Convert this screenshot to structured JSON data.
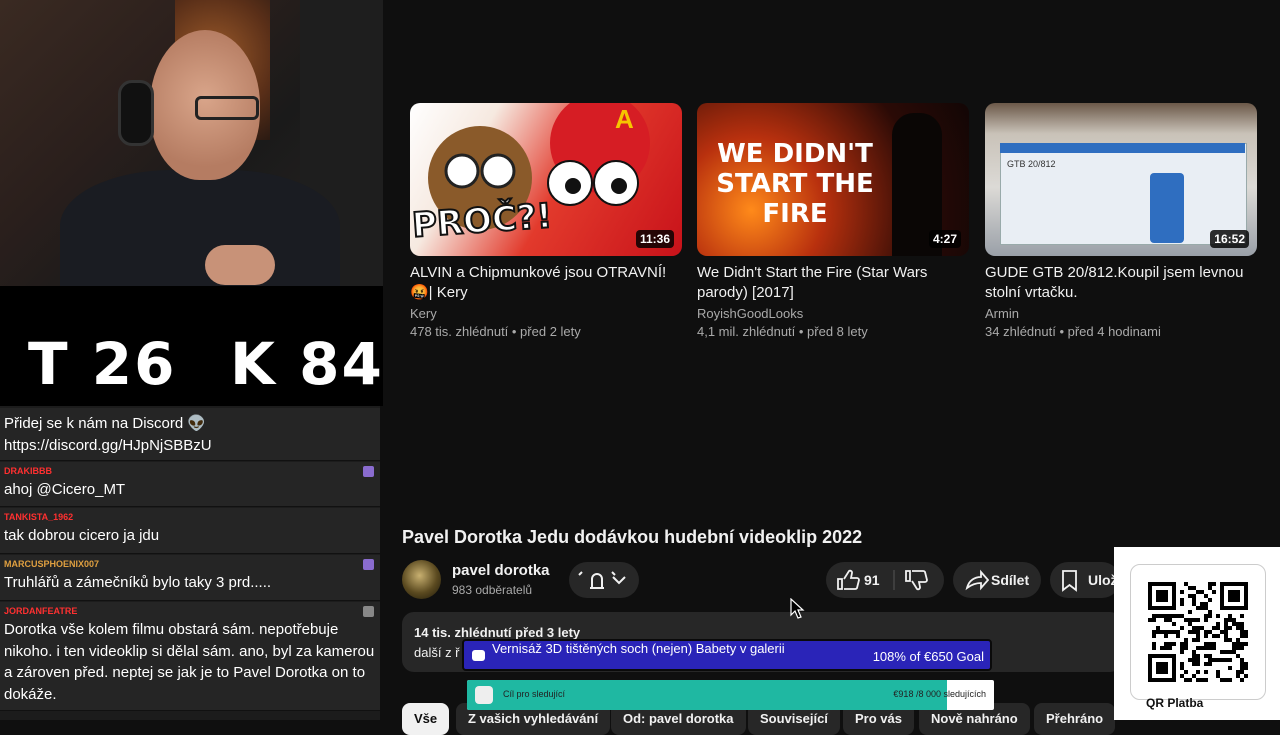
{
  "counter": {
    "t": "T 26",
    "k": "K 84"
  },
  "chat": [
    {
      "user": "",
      "text": "Přidej se k nám na Discord 👽 https://discord.gg/HJpNjSBBzU",
      "color": "#ffffff"
    },
    {
      "user": "DRAKIBBB",
      "text": "ahoj @Cicero_MT",
      "color": "#ff3030"
    },
    {
      "user": "TANKISTA_1962",
      "text": "tak dobrou cicero ja jdu",
      "color": "#ff3030"
    },
    {
      "user": "MARCUSPHOENIX007",
      "text": "Truhlářů a zámečníků bylo taky 3 prd.....",
      "color": "#e0a040"
    },
    {
      "user": "JORDANFEATRE",
      "text": "Dorotka vše kolem filmu obstará sám. nepotřebuje nikoho. i ten videoklip si dělal sám. ano, byl za kamerou a zároven před. neptej se jak je to Pavel Dorotka on to dokáže.",
      "color": "#ff3030"
    }
  ],
  "videos": [
    {
      "title": "ALVIN a Chipmunkové jsou OTRAVNÍ! 🤬| Kery",
      "channel": "Kery",
      "meta": "478 tis. zhlédnutí • před 2 lety",
      "duration": "11:36",
      "thumb_text": "PROČ?!"
    },
    {
      "title": "We Didn't Start the Fire (Star Wars parody) [2017]",
      "channel": "RoyishGoodLooks",
      "meta": "4,1 mil. zhlédnutí • před 8 lety",
      "duration": "4:27",
      "thumb_text": "WE DIDN'T START THE FIRE"
    },
    {
      "title": "GUDE GTB 20/812.Koupil jsem levnou stolní vrtačku.",
      "channel": "Armin",
      "meta": "34 zhlédnutí • před 4 hodinami",
      "duration": "16:52",
      "thumb_text": "GTB 20/812"
    }
  ],
  "main": {
    "title": "Pavel Dorotka Jedu dodávkou hudební videoklip 2022",
    "channel": "pavel dorotka",
    "subs": "983 odběratelů",
    "likes": "91",
    "share": "Sdílet",
    "save": "Ulož",
    "views": "14 tis. zhlédnutí  před 3 lety",
    "more": "další z ř"
  },
  "chips": [
    "Vše",
    "Z vašich vyhledávání",
    "Od: pavel dorotka",
    "Související",
    "Pro vás",
    "Nově nahráno",
    "Přehráno"
  ],
  "goal1": {
    "text": "Vernisáž 3D tištěných soch (nejen) Babety v galerii",
    "progress": "108% of €650 Goal"
  },
  "goal2": {
    "text": "Cíl pro sledující",
    "count": "€918 /8 000 sledujících",
    "fill": 0.91
  },
  "qr": {
    "label": "QR Platba"
  }
}
